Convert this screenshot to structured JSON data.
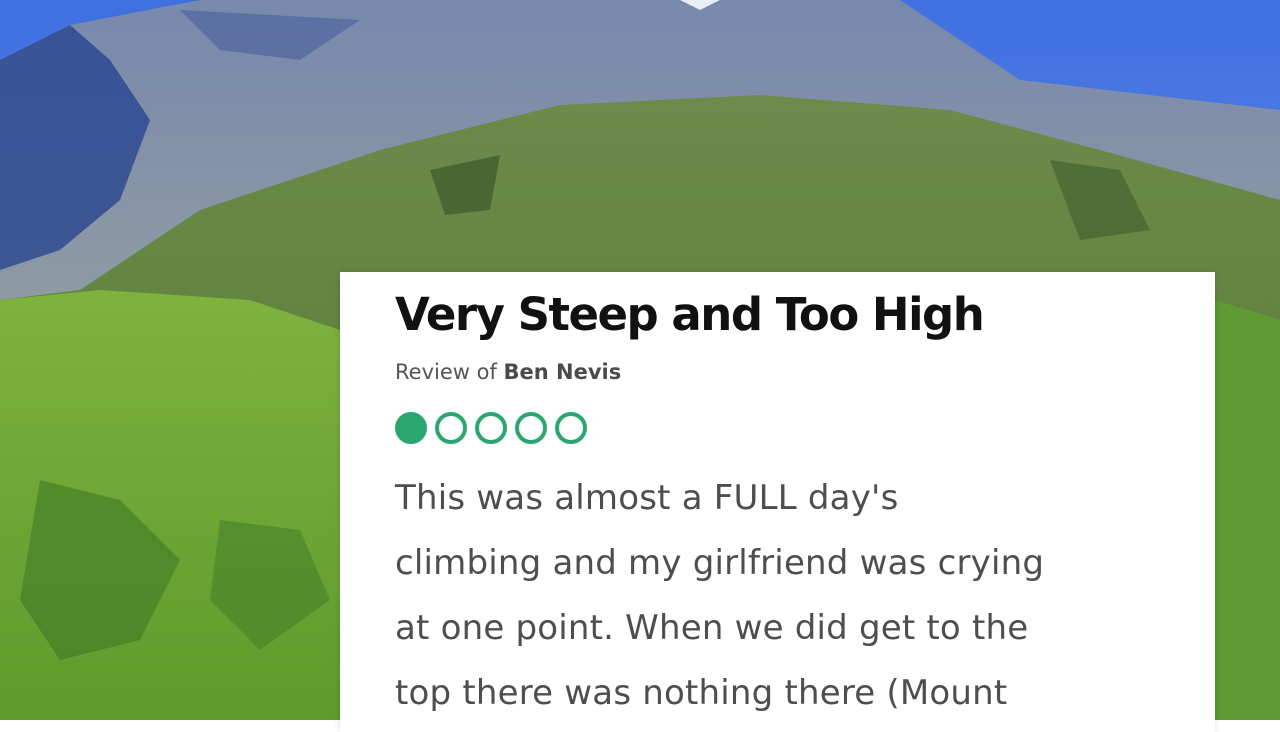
{
  "review": {
    "title": "Very Steep and Too High",
    "subtitle_prefix": "Review of ",
    "place": "Ben Nevis",
    "rating": 1,
    "rating_max": 5,
    "rating_color": "#2aa66f",
    "text_lines": [
      "This was almost a FULL day's",
      "climbing and my girlfriend was crying",
      "at one point. When we did get to the",
      "top there was nothing there (Mount"
    ]
  },
  "colors": {
    "sky": "#4f79d8",
    "grass": "#6faa3a",
    "rock": "#6b7fa4"
  }
}
